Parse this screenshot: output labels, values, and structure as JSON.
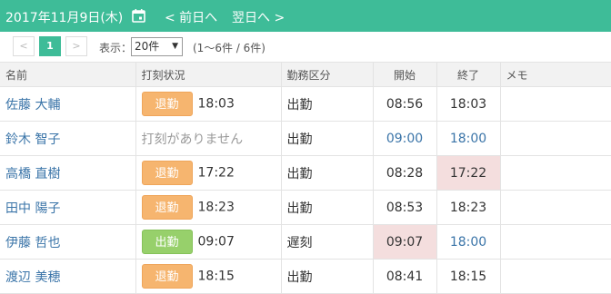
{
  "header": {
    "date": "2017年11月9日(木)",
    "prev": "< 前日へ",
    "next": "翌日へ >"
  },
  "toolbar": {
    "prev_page": "<",
    "page": "1",
    "next_page": ">",
    "display_label": "表示：",
    "per_page": "20件",
    "count": "(1〜6件 / 6件)"
  },
  "table": {
    "columns": [
      "名前",
      "打刻状況",
      "勤務区分",
      "開始",
      "終了",
      "メモ"
    ],
    "rows": [
      {
        "name": "佐藤 大輔",
        "badge": "退勤",
        "stamp_time": "18:03",
        "division": "出勤",
        "start": "08:56",
        "end": "18:03",
        "memo": ""
      },
      {
        "name": "鈴木 智子",
        "no_stamp": "打刻がありません",
        "division": "出勤",
        "start": "09:00",
        "end": "18:00",
        "memo": ""
      },
      {
        "name": "高橋 直樹",
        "badge": "退勤",
        "stamp_time": "17:22",
        "division": "出勤",
        "start": "08:28",
        "end": "17:22",
        "memo": ""
      },
      {
        "name": "田中 陽子",
        "badge": "退勤",
        "stamp_time": "18:23",
        "division": "出勤",
        "start": "08:53",
        "end": "18:23",
        "memo": ""
      },
      {
        "name": "伊藤 哲也",
        "badge": "出勤",
        "stamp_time": "09:07",
        "division": "遅刻",
        "start": "09:07",
        "end": "18:00",
        "memo": ""
      },
      {
        "name": "渡辺 美穂",
        "badge": "退勤",
        "stamp_time": "18:15",
        "division": "出勤",
        "start": "08:41",
        "end": "18:15",
        "memo": ""
      }
    ]
  },
  "colors": {
    "header_bg": "#3ebc98",
    "badge_out": "#f6b56f",
    "badge_in": "#97d06b",
    "highlight": "#f4dede",
    "link_blue": "#3a74a8"
  }
}
